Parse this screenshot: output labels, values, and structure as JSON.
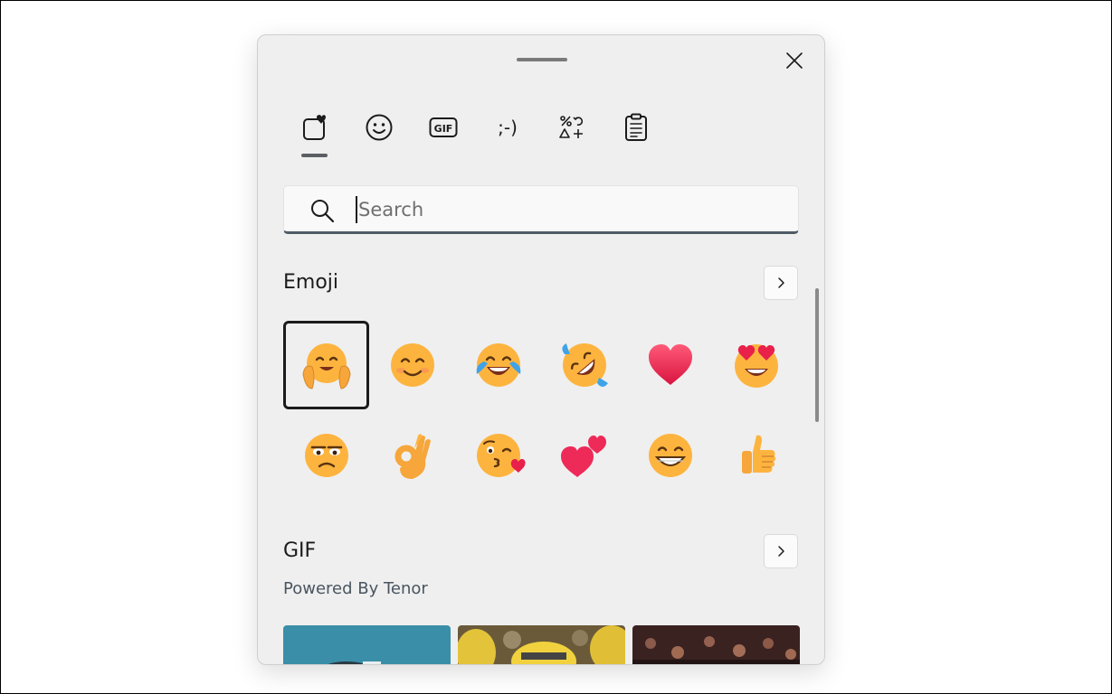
{
  "search": {
    "placeholder": "Search",
    "value": ""
  },
  "tabs": [
    {
      "name": "tab-recent",
      "icon": "heart-board-icon",
      "label": "",
      "selected": true
    },
    {
      "name": "tab-emoji",
      "icon": "smiley-icon",
      "label": "",
      "selected": false
    },
    {
      "name": "tab-gif",
      "icon": "gif-icon",
      "label": "",
      "selected": false
    },
    {
      "name": "tab-kaomoji",
      "icon": "kaomoji-icon",
      "label": ";-)",
      "selected": false
    },
    {
      "name": "tab-symbols",
      "icon": "symbols-icon",
      "label": "",
      "selected": false
    },
    {
      "name": "tab-clipboard",
      "icon": "clipboard-icon",
      "label": "",
      "selected": false
    }
  ],
  "emoji_section": {
    "title": "Emoji",
    "items": [
      {
        "icon": "hugging-face-icon",
        "selected": true
      },
      {
        "icon": "smiling-face-icon",
        "selected": false
      },
      {
        "icon": "face-with-tears-of-joy-icon",
        "selected": false
      },
      {
        "icon": "rolling-on-floor-laughing-icon",
        "selected": false
      },
      {
        "icon": "red-heart-icon",
        "selected": false
      },
      {
        "icon": "heart-eyes-icon",
        "selected": false
      },
      {
        "icon": "unamused-face-icon",
        "selected": false
      },
      {
        "icon": "ok-hand-icon",
        "selected": false
      },
      {
        "icon": "face-blowing-kiss-icon",
        "selected": false
      },
      {
        "icon": "two-hearts-icon",
        "selected": false
      },
      {
        "icon": "beaming-face-icon",
        "selected": false
      },
      {
        "icon": "thumbs-up-icon",
        "selected": false
      }
    ]
  },
  "gif_section": {
    "title": "GIF",
    "subtitle": "Powered By Tenor",
    "tiles": [
      "gif-thumbnail-blue",
      "gif-thumbnail-minions",
      "gif-thumbnail-crowd"
    ]
  },
  "colors": {
    "panel_bg": "#efefef",
    "accent_underline": "#4f5b66",
    "selection_border": "#1b1b1b"
  }
}
